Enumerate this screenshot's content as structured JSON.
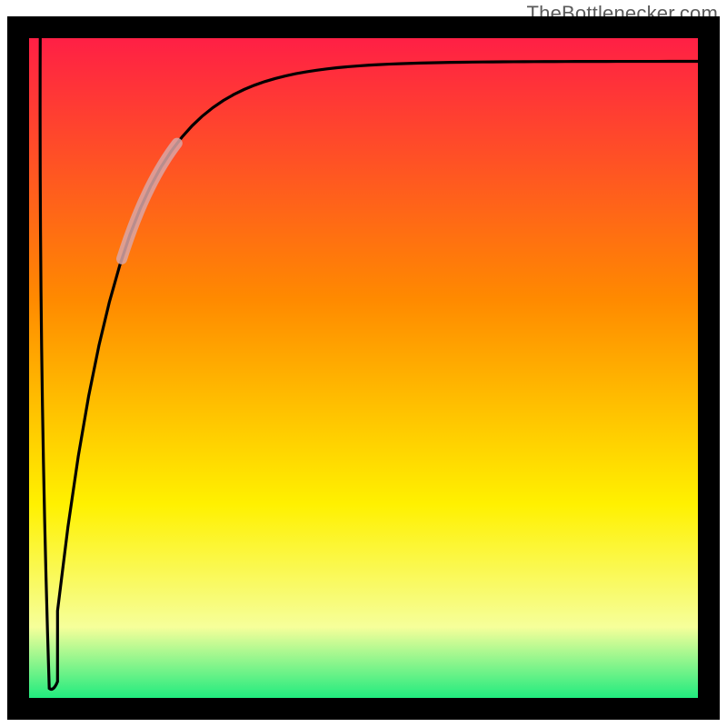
{
  "attribution": "TheBottlenecker.com",
  "chart_data": {
    "type": "line",
    "title": "",
    "xlabel": "",
    "ylabel": "",
    "xlim": [
      0,
      100
    ],
    "ylim": [
      0,
      100
    ],
    "gradient": {
      "top": "#ff1b48",
      "mid1": "#ff8a00",
      "mid2": "#fff100",
      "mid3": "#f6ff9a",
      "bottom": "#00e87a"
    },
    "curve": {
      "type": "v-shape-asymptotic",
      "dip_x": 4.5,
      "dip_y": 3,
      "left_start_y": 100,
      "right_asymptote_y": 95,
      "highlight_segment": {
        "x_start": 15,
        "x_end": 23
      }
    },
    "border_color": "#000000"
  }
}
